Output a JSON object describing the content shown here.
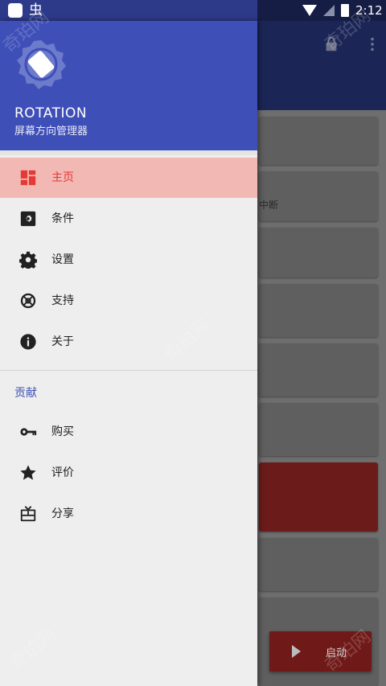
{
  "status_bar": {
    "time": "2:12",
    "app_icon_2": "虫"
  },
  "background_app": {
    "card_text_1": "中断",
    "fab_label": "启动"
  },
  "drawer": {
    "app_name": "ROTATION",
    "app_subtitle": "屏幕方向管理器",
    "items": [
      {
        "label": "主页",
        "icon": "dashboard-icon",
        "selected": true
      },
      {
        "label": "条件",
        "icon": "conditions-icon",
        "selected": false
      },
      {
        "label": "设置",
        "icon": "gear-icon",
        "selected": false
      },
      {
        "label": "支持",
        "icon": "lifebuoy-icon",
        "selected": false
      },
      {
        "label": "关于",
        "icon": "info-icon",
        "selected": false
      }
    ],
    "section_title": "贡献",
    "section_items": [
      {
        "label": "购买",
        "icon": "key-icon"
      },
      {
        "label": "评价",
        "icon": "star-icon"
      },
      {
        "label": "分享",
        "icon": "gift-icon"
      }
    ]
  },
  "watermarks": [
    "奇珀网",
    "奇珀网",
    "奇珀网",
    "奇珀网",
    "奇珀网"
  ],
  "colors": {
    "primary": "#3e4fb8",
    "accent": "#e53935",
    "selected_bg": "#f2b8b3",
    "drawer_bg": "#eeeeee"
  }
}
